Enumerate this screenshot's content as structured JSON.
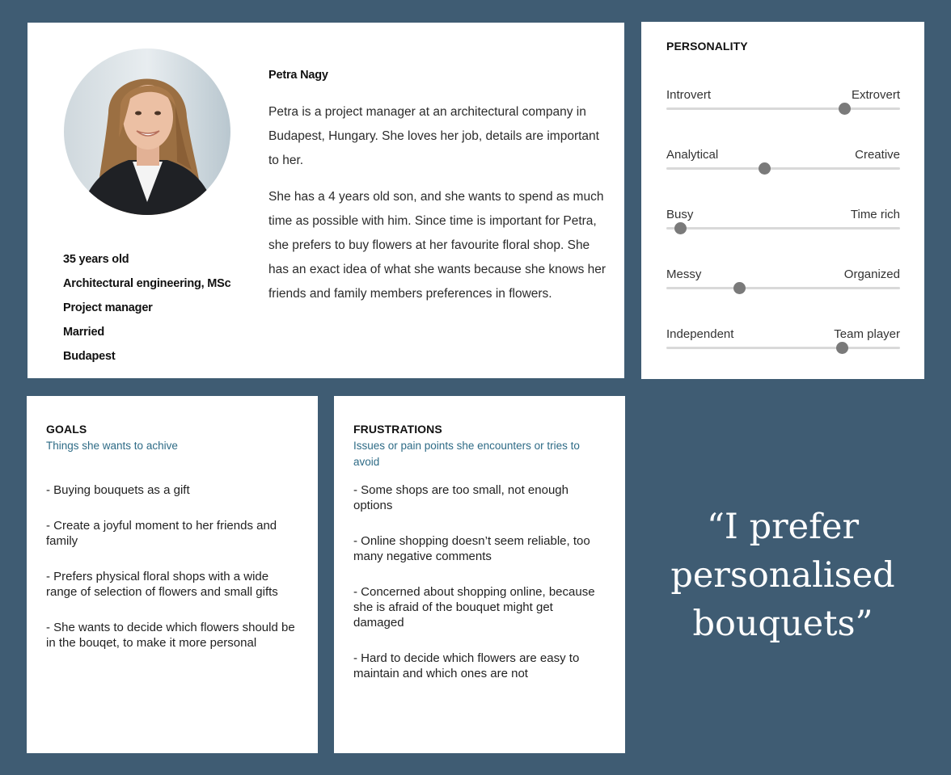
{
  "profile": {
    "name": "Petra Nagy",
    "facts": [
      "35 years old",
      "Architectural engineering, MSc",
      "Project manager",
      "Married",
      "Budapest"
    ],
    "bio": [
      "Petra is a project manager at an architectural company in Budapest, Hungary. She loves her job, details are important to her.",
      "She has a 4 years old son, and she wants to spend as much time as possible with him. Since time is important for Petra, she prefers to buy flowers at her favourite floral shop. She has an exact idea of what she wants because she knows her friends and family members preferences in flowers."
    ]
  },
  "personality": {
    "title": "PERSONALITY",
    "traits": [
      {
        "left": "Introvert",
        "right": "Extrovert",
        "level": 0.76
      },
      {
        "left": "Analytical",
        "right": "Creative",
        "level": 0.42
      },
      {
        "left": "Busy",
        "right": "Time rich",
        "level": 0.06
      },
      {
        "left": "Messy",
        "right": "Organized",
        "level": 0.31
      },
      {
        "left": "Independent",
        "right": "Team player",
        "level": 0.75
      }
    ]
  },
  "goals": {
    "title": "GOALS",
    "subtitle": "Things she wants to achive",
    "items": [
      "- Buying bouquets as a gift",
      "- Create a joyful moment to her friends and family",
      "- Prefers physical floral shops with a wide range of selection of flowers and small gifts",
      "- She wants to decide which flowers should be in the bouqet, to make it more personal"
    ]
  },
  "frustrations": {
    "title": "FRUSTRATIONS",
    "subtitle": "Issues or pain points she encounters or tries to avoid",
    "items": [
      "- Some shops are too small, not enough options",
      "- Online shopping doesn’t seem reliable, too many negative comments",
      "- Concerned about shopping online, because she is afraid of the bouquet might get damaged",
      "- Hard to decide which flowers are easy to maintain and which ones are not"
    ]
  },
  "quote": "“I prefer personalised bouquets”",
  "colors": {
    "background": "#3f5c73",
    "card": "#ffffff",
    "subtitle": "#2e6b86",
    "knob": "#7a7a7a",
    "track": "#d9d9d9"
  }
}
